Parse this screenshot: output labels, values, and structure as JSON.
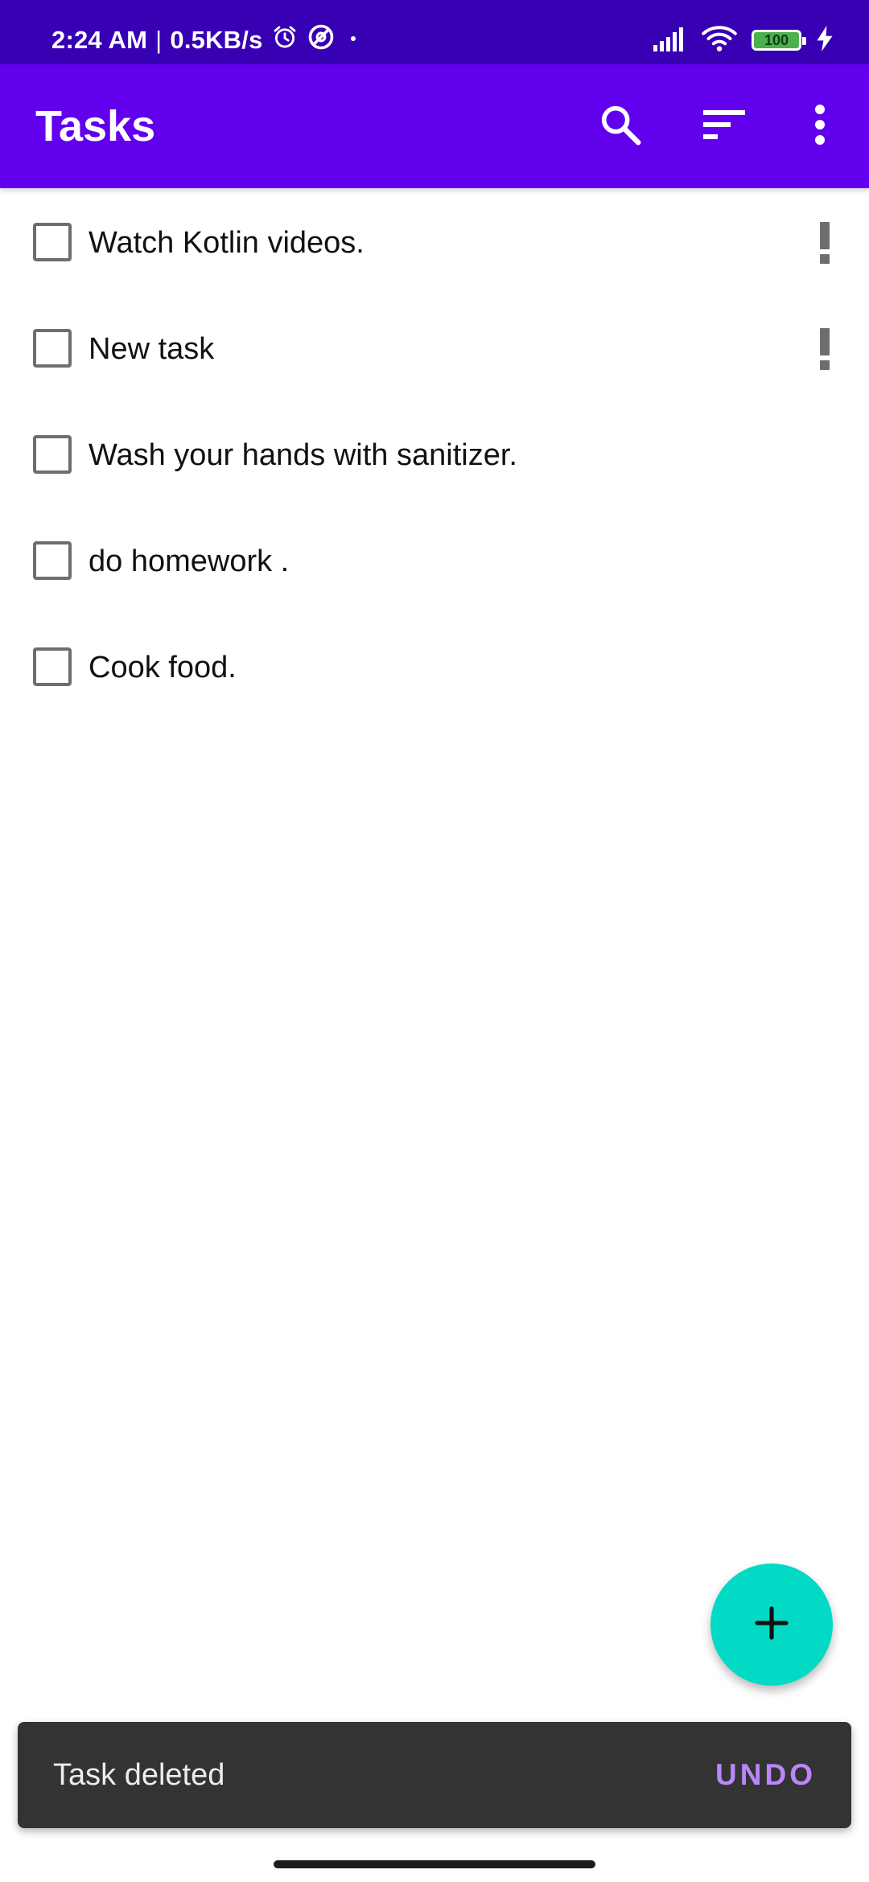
{
  "status_bar": {
    "time": "2:24 AM",
    "separator": "|",
    "network_speed": "0.5KB/s",
    "battery_level": "100",
    "icons": [
      "alarm-icon",
      "dnd-icon",
      "dot-icon",
      "signal-icon",
      "wifi-icon",
      "battery-icon",
      "charging-icon"
    ]
  },
  "app_bar": {
    "title": "Tasks",
    "actions": [
      "search-icon",
      "sort-icon",
      "more-vert-icon"
    ]
  },
  "tasks": [
    {
      "title": "Watch Kotlin videos.",
      "important": true,
      "done": false
    },
    {
      "title": "New task",
      "important": true,
      "done": false
    },
    {
      "title": "Wash your hands with sanitizer.",
      "important": false,
      "done": false
    },
    {
      "title": "do homework .",
      "important": false,
      "done": false
    },
    {
      "title": "Cook food.",
      "important": false,
      "done": false
    }
  ],
  "fab": {
    "icon": "add-icon"
  },
  "snackbar": {
    "message": "Task deleted",
    "action": "UNDO"
  },
  "colors": {
    "status_bar": "#3700B3",
    "app_bar": "#6200EE",
    "fab": "#03DAC5",
    "snackbar_bg": "#333333",
    "snackbar_action": "#BB86FC",
    "priority_icon": "#6e6e6e"
  }
}
